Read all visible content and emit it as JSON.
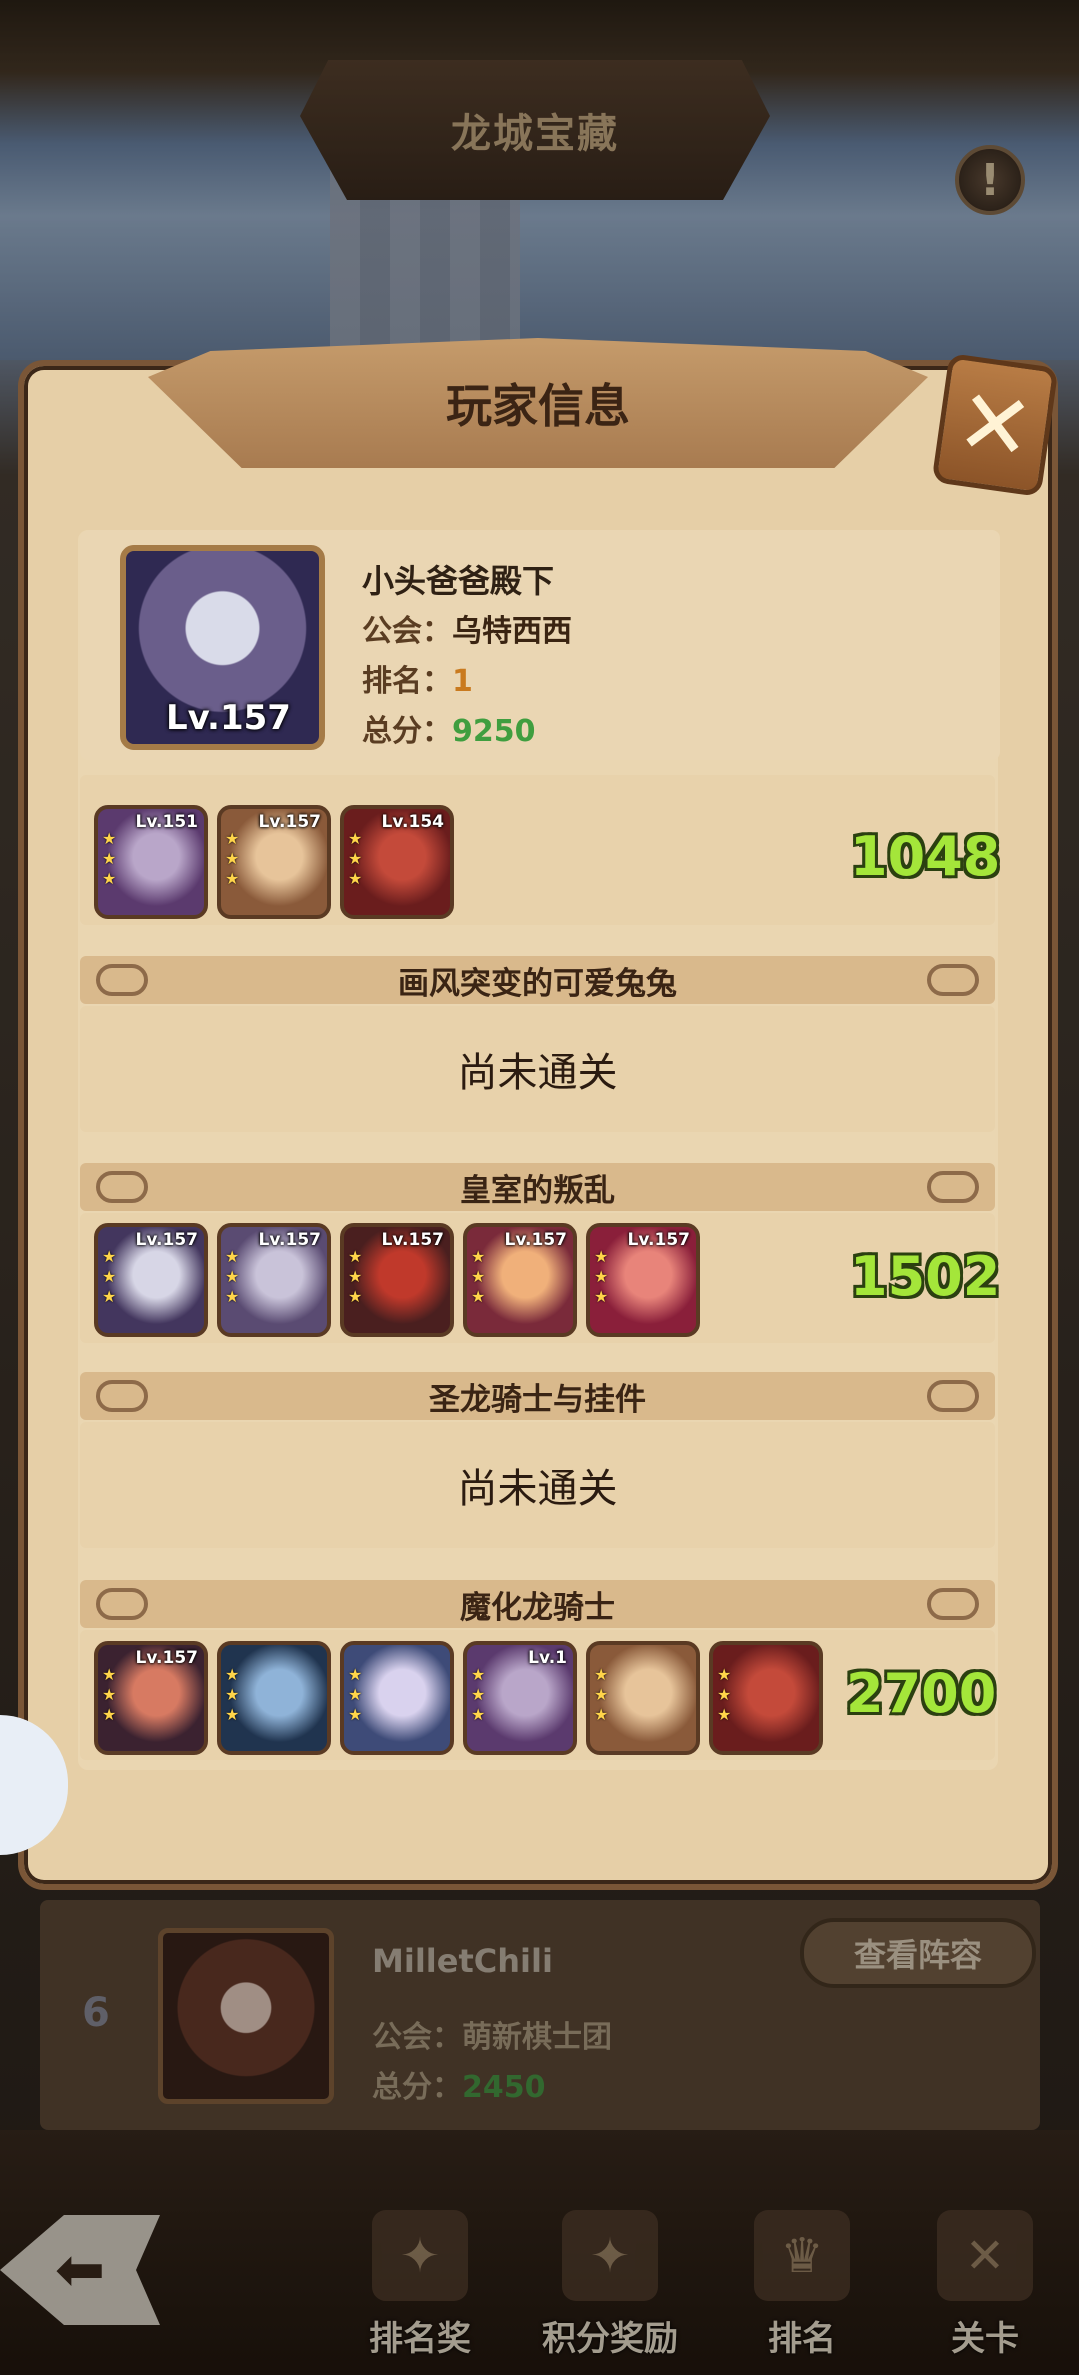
{
  "header": {
    "title": "龙城宝藏",
    "info_icon": "!"
  },
  "modal": {
    "title": "玩家信息",
    "close_icon": "close-icon",
    "player": {
      "name": "小头爸爸殿下",
      "level": "Lv.157",
      "guild_label": "公会：",
      "guild": "乌特西西",
      "rank_label": "排名：",
      "rank": "1",
      "score_label": "总分：",
      "score": "9250"
    },
    "sections": [
      {
        "title": "",
        "heroes": [
          "Lv.151",
          "Lv.157",
          "Lv.154"
        ],
        "power": "1048"
      },
      {
        "title": "画风突变的可爱兔兔",
        "status": "尚未通关"
      },
      {
        "title": "皇室的叛乱",
        "heroes": [
          "Lv.157",
          "Lv.157",
          "Lv.157",
          "Lv.157",
          "Lv.157"
        ],
        "power": "1502"
      },
      {
        "title": "圣龙骑士与挂件",
        "status": "尚未通关"
      },
      {
        "title": "魔化龙骑士",
        "heroes": [
          "Lv.157",
          "",
          "",
          "Lv.1",
          "",
          ""
        ],
        "power": "2700"
      }
    ]
  },
  "list_item": {
    "rank": "6",
    "name": "MilletChili",
    "guild_label": "公会：",
    "guild": "萌新棋士团",
    "score_label": "总分：",
    "score": "2450",
    "view_button": "查看阵容"
  },
  "nav": {
    "items": [
      {
        "label": "排名奖",
        "icon": "ranking-reward-icon"
      },
      {
        "label": "积分奖励",
        "icon": "points-reward-icon"
      },
      {
        "label": "排名",
        "icon": "ranking-icon"
      },
      {
        "label": "关卡",
        "icon": "stage-icon"
      }
    ]
  },
  "colors": {
    "power": "#a4e63a",
    "parchment": "#e6cfa7",
    "frame": "#7a5637"
  }
}
